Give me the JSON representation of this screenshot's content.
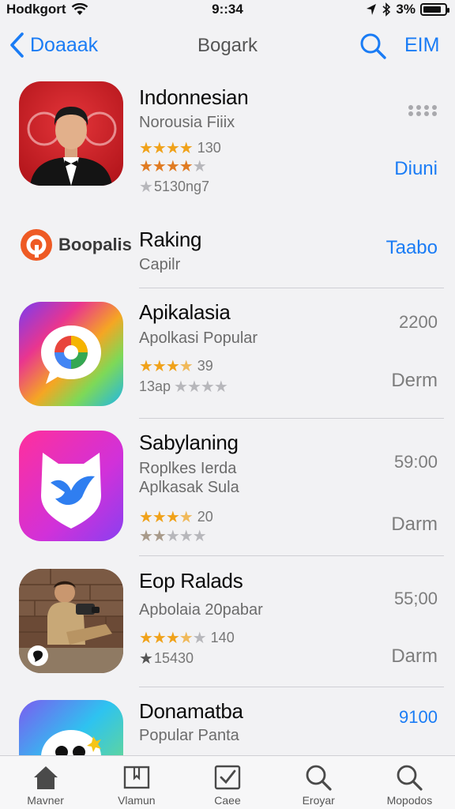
{
  "status_bar": {
    "carrier": "Hodkgort",
    "time": "9::34",
    "battery": "3%",
    "battery_level": 0.85,
    "wifi_icon": "wifi-icon",
    "location_icon": "location-arrow-icon",
    "bluetooth_icon": "bluetooth-icon"
  },
  "nav": {
    "back_label": "Doaaak",
    "title": "Bogark",
    "edit_label": "EIM"
  },
  "apps": [
    {
      "name": "Indonnesian",
      "subtitle": "Norousia Fiiix",
      "rating_text": "130",
      "rating_text2": "",
      "meta": "5130ng7",
      "right_label": "Diuni",
      "price": "",
      "menu_icon": "more-dots-icon"
    },
    {
      "name": "Raking",
      "subtitle": "Capilr",
      "logo_text": "Boopalis",
      "right_label": "Taabo"
    },
    {
      "name": "Apikalasia",
      "subtitle": "Apolkasi Popular",
      "rating_text": "39",
      "meta": "13ap",
      "price": "2200",
      "right_label": "Derm"
    },
    {
      "name": "Sabylaning",
      "subtitle": "Roplkes  Ierda",
      "subtitle2": "Aplkasak Sula",
      "rating_text": "20",
      "price": "59:00",
      "right_label": "Darm"
    },
    {
      "name": "Eop Ralads",
      "subtitle": "Apbolaia 20pabar",
      "rating_text": "140",
      "meta": "15430",
      "price": "55;00",
      "right_label": "Darm"
    },
    {
      "name": "Donamatba",
      "subtitle": "Popular Panta",
      "price": "9100"
    }
  ],
  "tabs": [
    {
      "label": "Mavner",
      "icon": "home-icon"
    },
    {
      "label": "Vlamun",
      "icon": "bookmark-icon"
    },
    {
      "label": "Caee",
      "icon": "checkbox-icon"
    },
    {
      "label": "Eroyar",
      "icon": "search-icon"
    },
    {
      "label": "Mopodos",
      "icon": "search-icon"
    }
  ],
  "colors": {
    "accent": "#1a7cf5",
    "star": "#f0a21a"
  }
}
